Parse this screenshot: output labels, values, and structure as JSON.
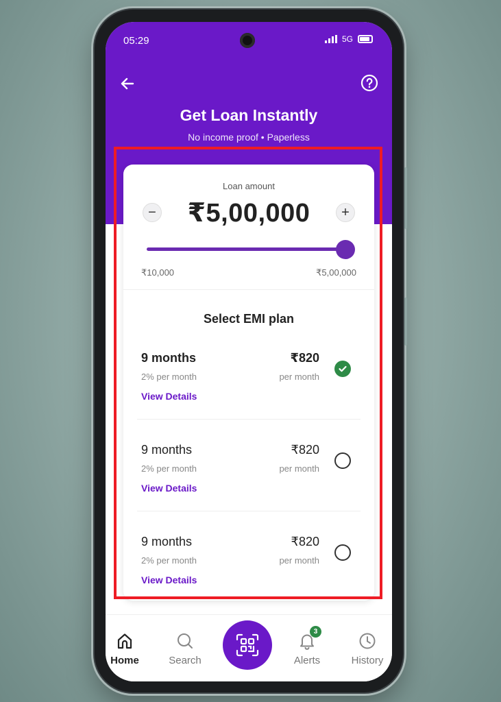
{
  "status_bar": {
    "time": "05:29",
    "network": "5G"
  },
  "header": {
    "back_icon": "back-arrow-icon",
    "help_icon": "help-icon",
    "title": "Get Loan Instantly",
    "subtitle": "No income proof • Paperless"
  },
  "loan": {
    "label": "Loan amount",
    "amount": "₹5,00,000",
    "minus": "−",
    "plus": "+",
    "min": "₹10,000",
    "max": "₹5,00,000",
    "slider_fraction": 1.0
  },
  "emi": {
    "title": "Select EMI plan",
    "plans": [
      {
        "months": "9 months",
        "rate": "2% per month",
        "price": "₹820",
        "per": "per month",
        "details": "View Details",
        "selected": true
      },
      {
        "months": "9 months",
        "rate": "2% per month",
        "price": "₹820",
        "per": "per month",
        "details": "View Details",
        "selected": false
      },
      {
        "months": "9 months",
        "rate": "2% per month",
        "price": "₹820",
        "per": "per month",
        "details": "View Details",
        "selected": false
      }
    ]
  },
  "nav": {
    "home": "Home",
    "search": "Search",
    "scan_icon": "qr-scan-icon",
    "alerts": "Alerts",
    "alerts_badge": "3",
    "history": "History"
  },
  "colors": {
    "brand": "#6a19c8",
    "selected": "#2e8b47",
    "highlight": "#ee1c25"
  }
}
